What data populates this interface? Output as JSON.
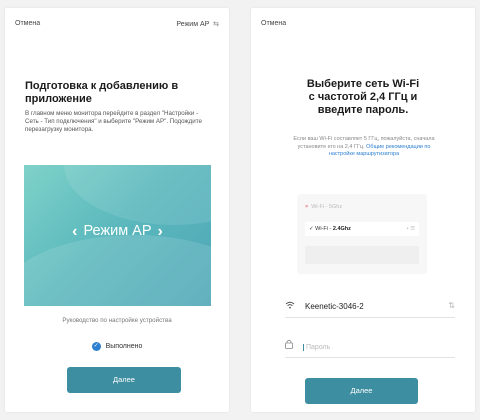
{
  "left_screen": {
    "cancel_label": "Отмена",
    "mode_link": "Режим AP",
    "mode_link_arrow": "⇆",
    "title": "Подготовка к добавлению в приложение",
    "description": "В главном меню монитора перейдите в раздел \"Настройки - Сеть - Тип подключения\" и выберите \"Режим AP\". Подождите перезагрузку монитора.",
    "banner_label": "Режим AP",
    "guide_link": "Руководство по настройке устройства",
    "done_label": "Выполнено",
    "next_button": "Далее",
    "banner_colors": [
      "#7fd2c9",
      "#4da6b7"
    ]
  },
  "right_screen": {
    "cancel_label": "Отмена",
    "title_line1": "Выберите сеть Wi-Fi",
    "title_line2": "с частотой 2,4 ГГц и",
    "title_line3": "введите пароль.",
    "note_text": "Если ваш Wi-Fi составляет 5 ГГц, пожалуйста, сначала установите его на 2,4 ГГц.",
    "note_link": "Общие рекомендации по настройке маршрутизатора",
    "network_illustration": {
      "row1": "Wi-Fi - 5Ghz",
      "row2_prefix": "Wi-Fi -",
      "row2_strong": "2.4Ghz",
      "dots": "• ☰"
    },
    "wifi_name": "Keenetic-3046-2",
    "password_placeholder": "Пароль",
    "next_button": "Далее",
    "accent_color": "#3d8ea0"
  }
}
